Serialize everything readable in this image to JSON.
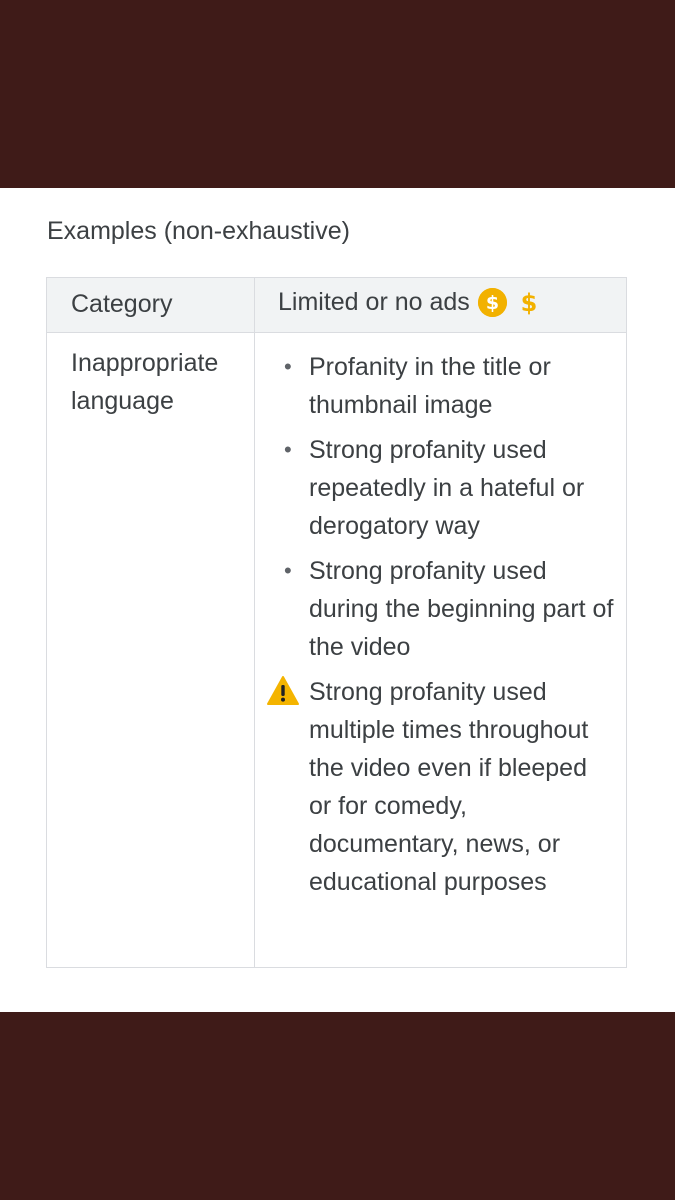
{
  "heading": "Examples (non-exhaustive)",
  "table": {
    "headers": {
      "category": "Category",
      "ads": "Limited or no ads"
    },
    "row": {
      "category": "Inappropriate language",
      "items": [
        {
          "icon": "bullet",
          "text": "Profanity in the title or thumbnail image"
        },
        {
          "icon": "bullet",
          "text": "Strong profanity used repeatedly in a hateful or derogatory way"
        },
        {
          "icon": "bullet",
          "text": "Strong profanity used during the beginning part of the video"
        },
        {
          "icon": "warning-icon",
          "text": "Strong profanity used multiple times throughout the video even if bleeped or for comedy, documentary, news, or educational purposes"
        }
      ]
    }
  },
  "icons": {
    "header": [
      "coin-dollar-icon",
      "dollar-icon"
    ]
  },
  "colors": {
    "band": "#3f1b18",
    "coin": "#f2b100",
    "warning": "#f4b400",
    "text": "#3c4043",
    "header_bg": "#f1f3f4",
    "border": "#dadce0"
  }
}
